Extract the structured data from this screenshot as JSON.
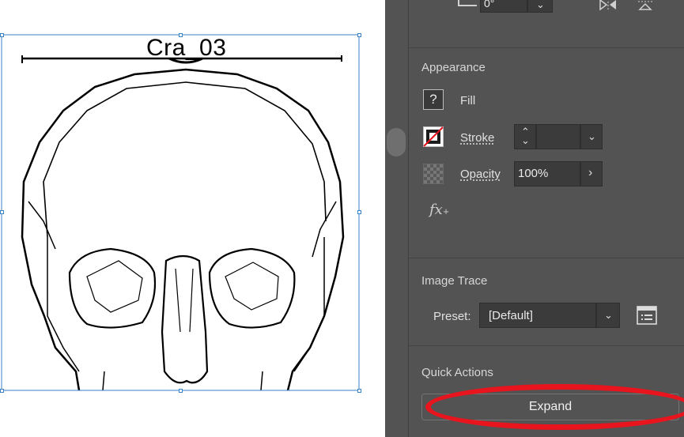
{
  "artwork": {
    "label": "Cra_03"
  },
  "top_row": {
    "value": "0°"
  },
  "appearance": {
    "title": "Appearance",
    "fill_label": "Fill",
    "fill_swatch_glyph": "?",
    "stroke_label": "Stroke",
    "opacity_label": "Opacity",
    "opacity_value": "100%",
    "fx_label": "fx"
  },
  "image_trace": {
    "title": "Image Trace",
    "preset_label": "Preset:",
    "preset_value": "[Default]"
  },
  "quick_actions": {
    "title": "Quick Actions",
    "expand_label": "Expand"
  },
  "colors": {
    "panel_bg": "#535353",
    "field_bg": "#3b3b3b",
    "selection_blue": "#3b82c4",
    "annotation_red": "#e8141e"
  }
}
